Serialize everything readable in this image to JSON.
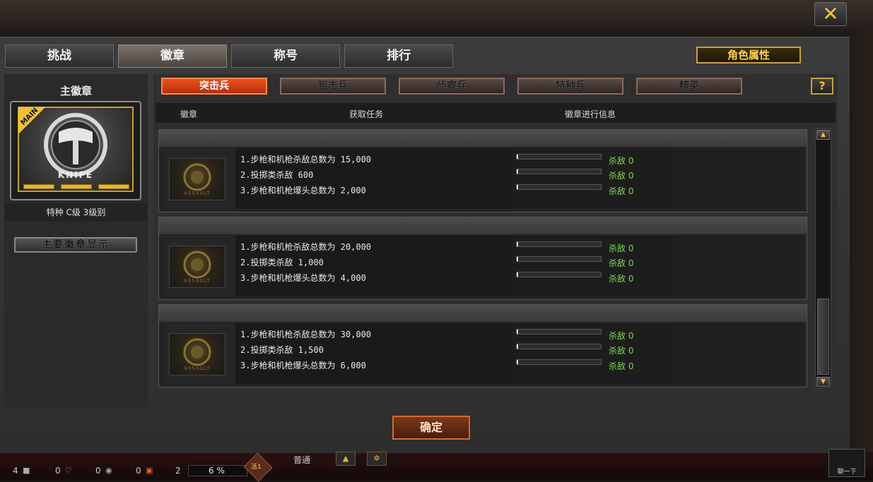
{
  "main_tabs": [
    "挑战",
    "徽章",
    "称号",
    "排行"
  ],
  "active_main_tab": 1,
  "attributes_button": "角色属性",
  "close_label": "✕",
  "left": {
    "title": "主徽章",
    "ribbon": "MAIN",
    "badge_name": "KNIFE",
    "caption": "特种 C级 3级别",
    "equip_button": "主要徽章显示"
  },
  "sub_tabs": [
    "突击兵",
    "狙击兵",
    "侦察兵",
    "特种兵",
    "精英"
  ],
  "active_sub_tab": 0,
  "help_label": "?",
  "table": {
    "headers": [
      "徽章",
      "获取任务",
      "徽章进行信息"
    ]
  },
  "groups": [
    {
      "icon_text": "ASSAULT",
      "tasks": [
        "1.步枪和机枪杀敌总数为 15,000",
        "2.投掷类杀敌 600",
        "3.步枪和机枪爆头总数为 2,000"
      ],
      "progress": [
        {
          "label": "杀敌 0",
          "fraction": 0.01
        },
        {
          "label": "杀敌 0",
          "fraction": 0.01
        },
        {
          "label": "杀敌 0",
          "fraction": 0.01
        }
      ]
    },
    {
      "icon_text": "ASSAULT",
      "tasks": [
        "1.步枪和机枪杀敌总数为 20,000",
        "2.投掷类杀敌 1,000",
        "3.步枪和机枪爆头总数为 4,000"
      ],
      "progress": [
        {
          "label": "杀敌 0",
          "fraction": 0.01
        },
        {
          "label": "杀敌 0",
          "fraction": 0.01
        },
        {
          "label": "杀敌 0",
          "fraction": 0.01
        }
      ]
    },
    {
      "icon_text": "ASSAULT",
      "tasks": [
        "1.步枪和机枪杀敌总数为 30,000",
        "2.投掷类杀敌 1,500",
        "3.步枪和机枪爆头总数为 6,000"
      ],
      "progress": [
        {
          "label": "杀敌 0",
          "fraction": 0.01
        },
        {
          "label": "杀敌 0",
          "fraction": 0.01
        },
        {
          "label": "杀敌 0",
          "fraction": 0.01
        }
      ]
    }
  ],
  "confirm_button": "确定",
  "status_bar": {
    "count1": "4",
    "count2": "0",
    "count3": "0",
    "count4": "0",
    "count5": "2",
    "percent": "6 %",
    "level": "活1",
    "mode": "普通",
    "corner_label": "聊一下"
  },
  "colors": {
    "accent": "#f2c232",
    "active_subtab": "#e0461a",
    "kill_text": "#7bd94e"
  }
}
